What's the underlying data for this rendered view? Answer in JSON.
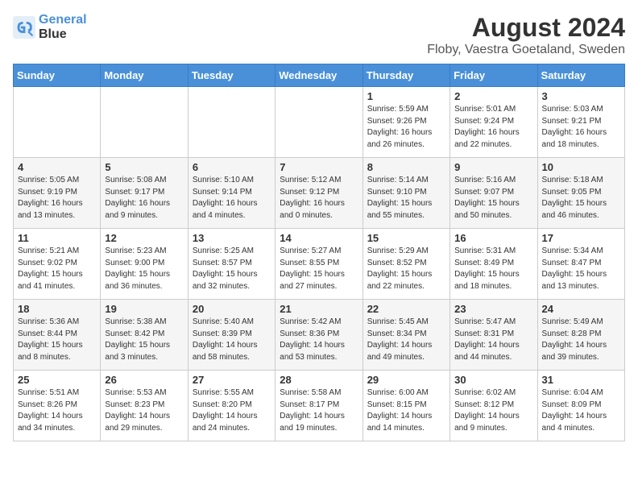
{
  "app": {
    "logo_line1": "General",
    "logo_line2": "Blue"
  },
  "title": "August 2024",
  "subtitle": "Floby, Vaestra Goetaland, Sweden",
  "days_of_week": [
    "Sunday",
    "Monday",
    "Tuesday",
    "Wednesday",
    "Thursday",
    "Friday",
    "Saturday"
  ],
  "weeks": [
    [
      {
        "day": "",
        "sunrise": "",
        "sunset": "",
        "daylight": ""
      },
      {
        "day": "",
        "sunrise": "",
        "sunset": "",
        "daylight": ""
      },
      {
        "day": "",
        "sunrise": "",
        "sunset": "",
        "daylight": ""
      },
      {
        "day": "",
        "sunrise": "",
        "sunset": "",
        "daylight": ""
      },
      {
        "day": "1",
        "sunrise": "5:59 AM",
        "sunset": "9:26 PM",
        "daylight": "Daylight: 16 hours and 26 minutes."
      },
      {
        "day": "2",
        "sunrise": "5:01 AM",
        "sunset": "9:24 PM",
        "daylight": "Daylight: 16 hours and 22 minutes."
      },
      {
        "day": "3",
        "sunrise": "5:03 AM",
        "sunset": "9:21 PM",
        "daylight": "Daylight: 16 hours and 18 minutes."
      }
    ],
    [
      {
        "day": "4",
        "sunrise": "5:05 AM",
        "sunset": "9:19 PM",
        "daylight": "Daylight: 16 hours and 13 minutes."
      },
      {
        "day": "5",
        "sunrise": "5:08 AM",
        "sunset": "9:17 PM",
        "daylight": "Daylight: 16 hours and 9 minutes."
      },
      {
        "day": "6",
        "sunrise": "5:10 AM",
        "sunset": "9:14 PM",
        "daylight": "Daylight: 16 hours and 4 minutes."
      },
      {
        "day": "7",
        "sunrise": "5:12 AM",
        "sunset": "9:12 PM",
        "daylight": "Daylight: 16 hours and 0 minutes."
      },
      {
        "day": "8",
        "sunrise": "5:14 AM",
        "sunset": "9:10 PM",
        "daylight": "Daylight: 15 hours and 55 minutes."
      },
      {
        "day": "9",
        "sunrise": "5:16 AM",
        "sunset": "9:07 PM",
        "daylight": "Daylight: 15 hours and 50 minutes."
      },
      {
        "day": "10",
        "sunrise": "5:18 AM",
        "sunset": "9:05 PM",
        "daylight": "Daylight: 15 hours and 46 minutes."
      }
    ],
    [
      {
        "day": "11",
        "sunrise": "5:21 AM",
        "sunset": "9:02 PM",
        "daylight": "Daylight: 15 hours and 41 minutes."
      },
      {
        "day": "12",
        "sunrise": "5:23 AM",
        "sunset": "9:00 PM",
        "daylight": "Daylight: 15 hours and 36 minutes."
      },
      {
        "day": "13",
        "sunrise": "5:25 AM",
        "sunset": "8:57 PM",
        "daylight": "Daylight: 15 hours and 32 minutes."
      },
      {
        "day": "14",
        "sunrise": "5:27 AM",
        "sunset": "8:55 PM",
        "daylight": "Daylight: 15 hours and 27 minutes."
      },
      {
        "day": "15",
        "sunrise": "5:29 AM",
        "sunset": "8:52 PM",
        "daylight": "Daylight: 15 hours and 22 minutes."
      },
      {
        "day": "16",
        "sunrise": "5:31 AM",
        "sunset": "8:49 PM",
        "daylight": "Daylight: 15 hours and 18 minutes."
      },
      {
        "day": "17",
        "sunrise": "5:34 AM",
        "sunset": "8:47 PM",
        "daylight": "Daylight: 15 hours and 13 minutes."
      }
    ],
    [
      {
        "day": "18",
        "sunrise": "5:36 AM",
        "sunset": "8:44 PM",
        "daylight": "Daylight: 15 hours and 8 minutes."
      },
      {
        "day": "19",
        "sunrise": "5:38 AM",
        "sunset": "8:42 PM",
        "daylight": "Daylight: 15 hours and 3 minutes."
      },
      {
        "day": "20",
        "sunrise": "5:40 AM",
        "sunset": "8:39 PM",
        "daylight": "Daylight: 14 hours and 58 minutes."
      },
      {
        "day": "21",
        "sunrise": "5:42 AM",
        "sunset": "8:36 PM",
        "daylight": "Daylight: 14 hours and 53 minutes."
      },
      {
        "day": "22",
        "sunrise": "5:45 AM",
        "sunset": "8:34 PM",
        "daylight": "Daylight: 14 hours and 49 minutes."
      },
      {
        "day": "23",
        "sunrise": "5:47 AM",
        "sunset": "8:31 PM",
        "daylight": "Daylight: 14 hours and 44 minutes."
      },
      {
        "day": "24",
        "sunrise": "5:49 AM",
        "sunset": "8:28 PM",
        "daylight": "Daylight: 14 hours and 39 minutes."
      }
    ],
    [
      {
        "day": "25",
        "sunrise": "5:51 AM",
        "sunset": "8:26 PM",
        "daylight": "Daylight: 14 hours and 34 minutes."
      },
      {
        "day": "26",
        "sunrise": "5:53 AM",
        "sunset": "8:23 PM",
        "daylight": "Daylight: 14 hours and 29 minutes."
      },
      {
        "day": "27",
        "sunrise": "5:55 AM",
        "sunset": "8:20 PM",
        "daylight": "Daylight: 14 hours and 24 minutes."
      },
      {
        "day": "28",
        "sunrise": "5:58 AM",
        "sunset": "8:17 PM",
        "daylight": "Daylight: 14 hours and 19 minutes."
      },
      {
        "day": "29",
        "sunrise": "6:00 AM",
        "sunset": "8:15 PM",
        "daylight": "Daylight: 14 hours and 14 minutes."
      },
      {
        "day": "30",
        "sunrise": "6:02 AM",
        "sunset": "8:12 PM",
        "daylight": "Daylight: 14 hours and 9 minutes."
      },
      {
        "day": "31",
        "sunrise": "6:04 AM",
        "sunset": "8:09 PM",
        "daylight": "Daylight: 14 hours and 4 minutes."
      }
    ]
  ]
}
